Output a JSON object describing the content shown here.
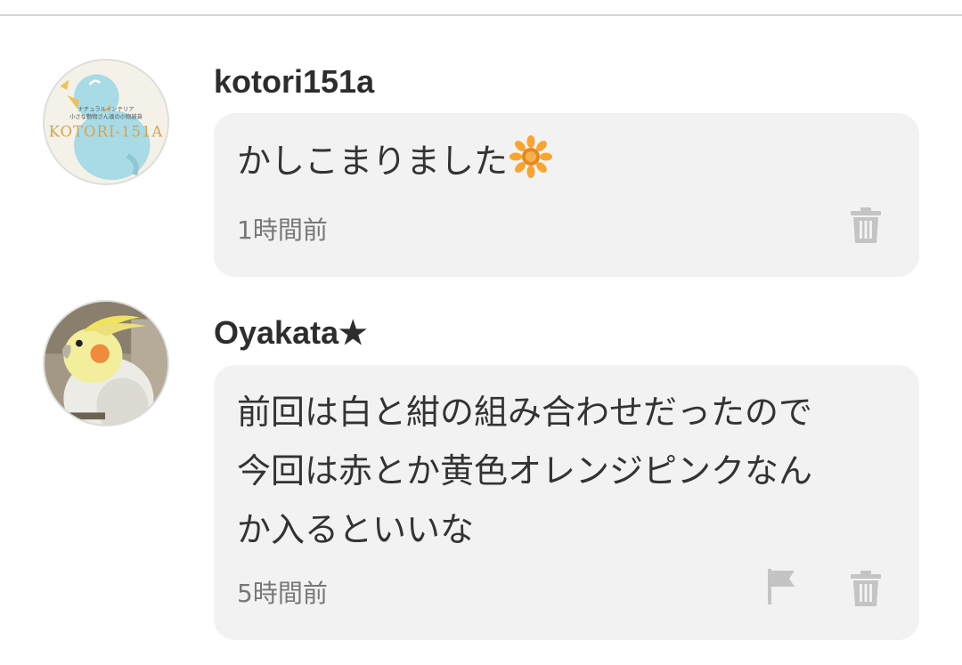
{
  "comments": [
    {
      "username": "kotori151a",
      "text_lines": [
        "かしこまりました"
      ],
      "emoji": "sunflower-icon",
      "time": "1時間前",
      "actions": [
        "trash-icon"
      ],
      "avatar": {
        "logo_small_line1": "ナチュラルインテリア",
        "logo_small_line2": "小さな動物さん達の小物雑貨",
        "logo_main": "KOTORI-151A"
      }
    },
    {
      "username": "Oyakata★",
      "text_lines": [
        "前回は白と紺の組み合わせだったので",
        "今回は赤とか黄色オレンジピンクなん",
        "か入るといいな"
      ],
      "time": "5時間前",
      "actions": [
        "flag-icon",
        "trash-icon"
      ],
      "avatar": {
        "subject": "cockatiel-photo"
      }
    }
  ],
  "colors": {
    "bubble_bg": "#f2f2f2",
    "icon_gray": "#c4c4c4",
    "timestamp": "#777777",
    "username": "#2d2d2d",
    "logo_text": "#d9a24a",
    "bird_blue": "#a9dbe6"
  }
}
